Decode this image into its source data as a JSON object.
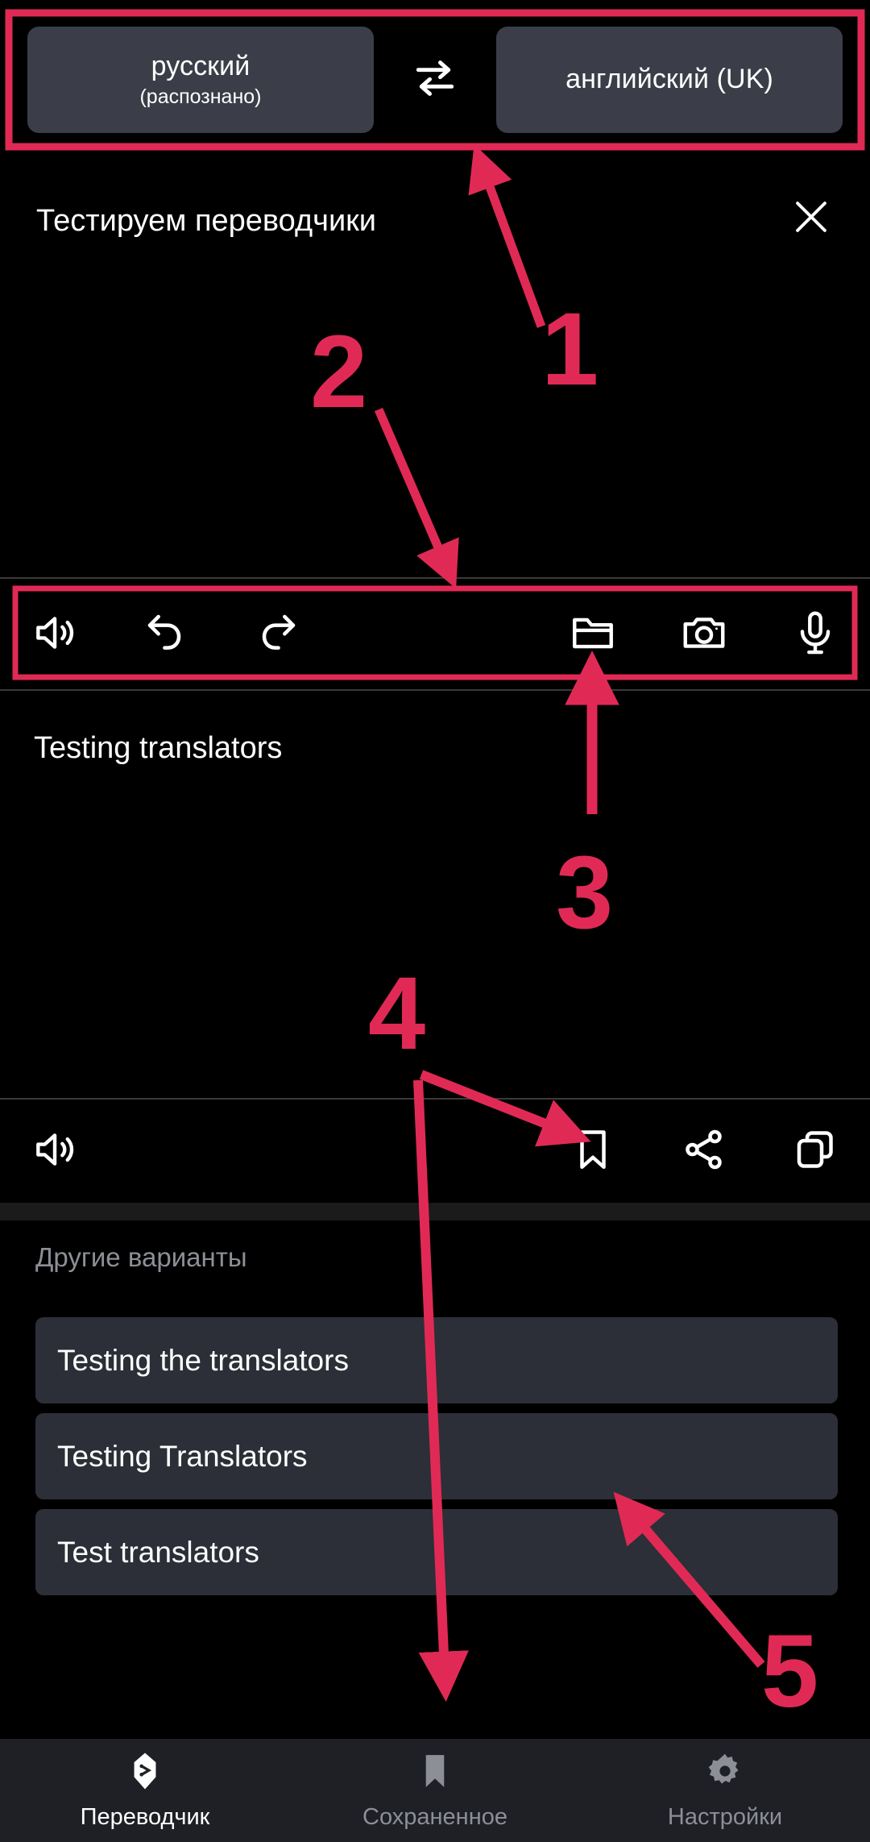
{
  "accent_color": "#e02a55",
  "background_color": "#000000",
  "chip_color": "#3b3e48",
  "card_color": "#2c2f37",
  "nav_color": "#1f2025",
  "language_bar": {
    "source": {
      "name": "русский",
      "detected_note": "(распознано)"
    },
    "target": {
      "name": "английский (UK)"
    },
    "swap_icon": "swap-horizontal-icon"
  },
  "source_panel": {
    "text": "Тестируем переводчики",
    "close_icon": "close-icon"
  },
  "input_toolbar": {
    "items": [
      {
        "icon": "speaker-icon",
        "label": "Озвучить"
      },
      {
        "icon": "undo-icon",
        "label": "Отменить"
      },
      {
        "icon": "redo-icon",
        "label": "Повторить"
      },
      {
        "icon": "folder-icon",
        "label": "Файл"
      },
      {
        "icon": "camera-icon",
        "label": "Камера"
      },
      {
        "icon": "microphone-icon",
        "label": "Микрофон"
      }
    ]
  },
  "translation_panel": {
    "text": "Testing translators"
  },
  "output_toolbar": {
    "items": [
      {
        "icon": "speaker-icon",
        "label": "Озвучить"
      },
      {
        "icon": "bookmark-icon",
        "label": "Сохранить"
      },
      {
        "icon": "share-icon",
        "label": "Поделиться"
      },
      {
        "icon": "copy-icon",
        "label": "Копировать"
      }
    ]
  },
  "alternatives": {
    "title": "Другие варианты",
    "items": [
      "Testing the translators",
      "Testing Translators",
      "Test translators"
    ]
  },
  "bottom_nav": {
    "items": [
      {
        "label": "Переводчик",
        "icon": "translator-icon",
        "active": true
      },
      {
        "label": "Сохраненное",
        "icon": "bookmark-icon",
        "active": false
      },
      {
        "label": "Настройки",
        "icon": "gear-icon",
        "active": false
      }
    ]
  },
  "annotations": {
    "markers": [
      {
        "number": "1",
        "target": "language-bar"
      },
      {
        "number": "2",
        "target": "input-toolbar"
      },
      {
        "number": "3",
        "target": "folder-icon"
      },
      {
        "number": "4",
        "target": "bookmark-icon"
      },
      {
        "number": "5",
        "target": "alternatives-list"
      }
    ]
  }
}
